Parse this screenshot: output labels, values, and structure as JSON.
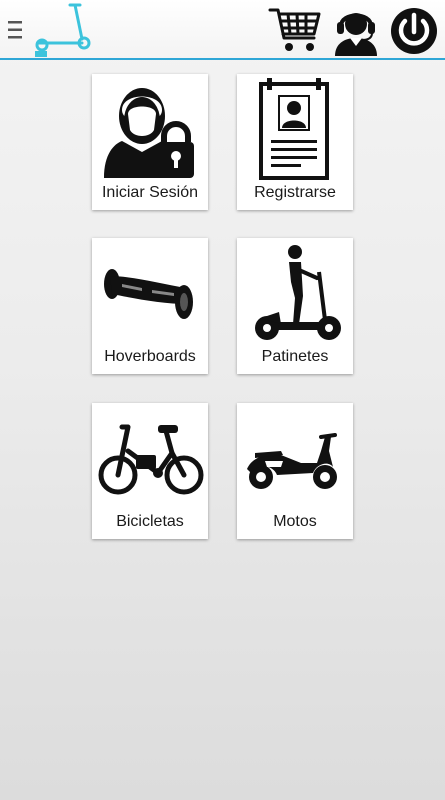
{
  "header": {
    "menu_icon": "hamburger-menu-icon",
    "logo_icon": "scooter-logo-icon",
    "cart_icon": "shopping-cart-icon",
    "support_icon": "customer-support-icon",
    "power_icon": "power-icon",
    "accent_color": "#2ea6d6",
    "logo_color": "#3cc3dc"
  },
  "tiles": [
    {
      "label": "Iniciar Sesión",
      "icon": "user-lock-icon"
    },
    {
      "label": "Registrarse",
      "icon": "id-badge-icon"
    },
    {
      "label": "Hoverboards",
      "icon": "hoverboard-icon"
    },
    {
      "label": "Patinetes",
      "icon": "scooter-rider-icon"
    },
    {
      "label": "Bicicletas",
      "icon": "bicycle-icon"
    },
    {
      "label": "Motos",
      "icon": "motorbike-icon"
    }
  ]
}
